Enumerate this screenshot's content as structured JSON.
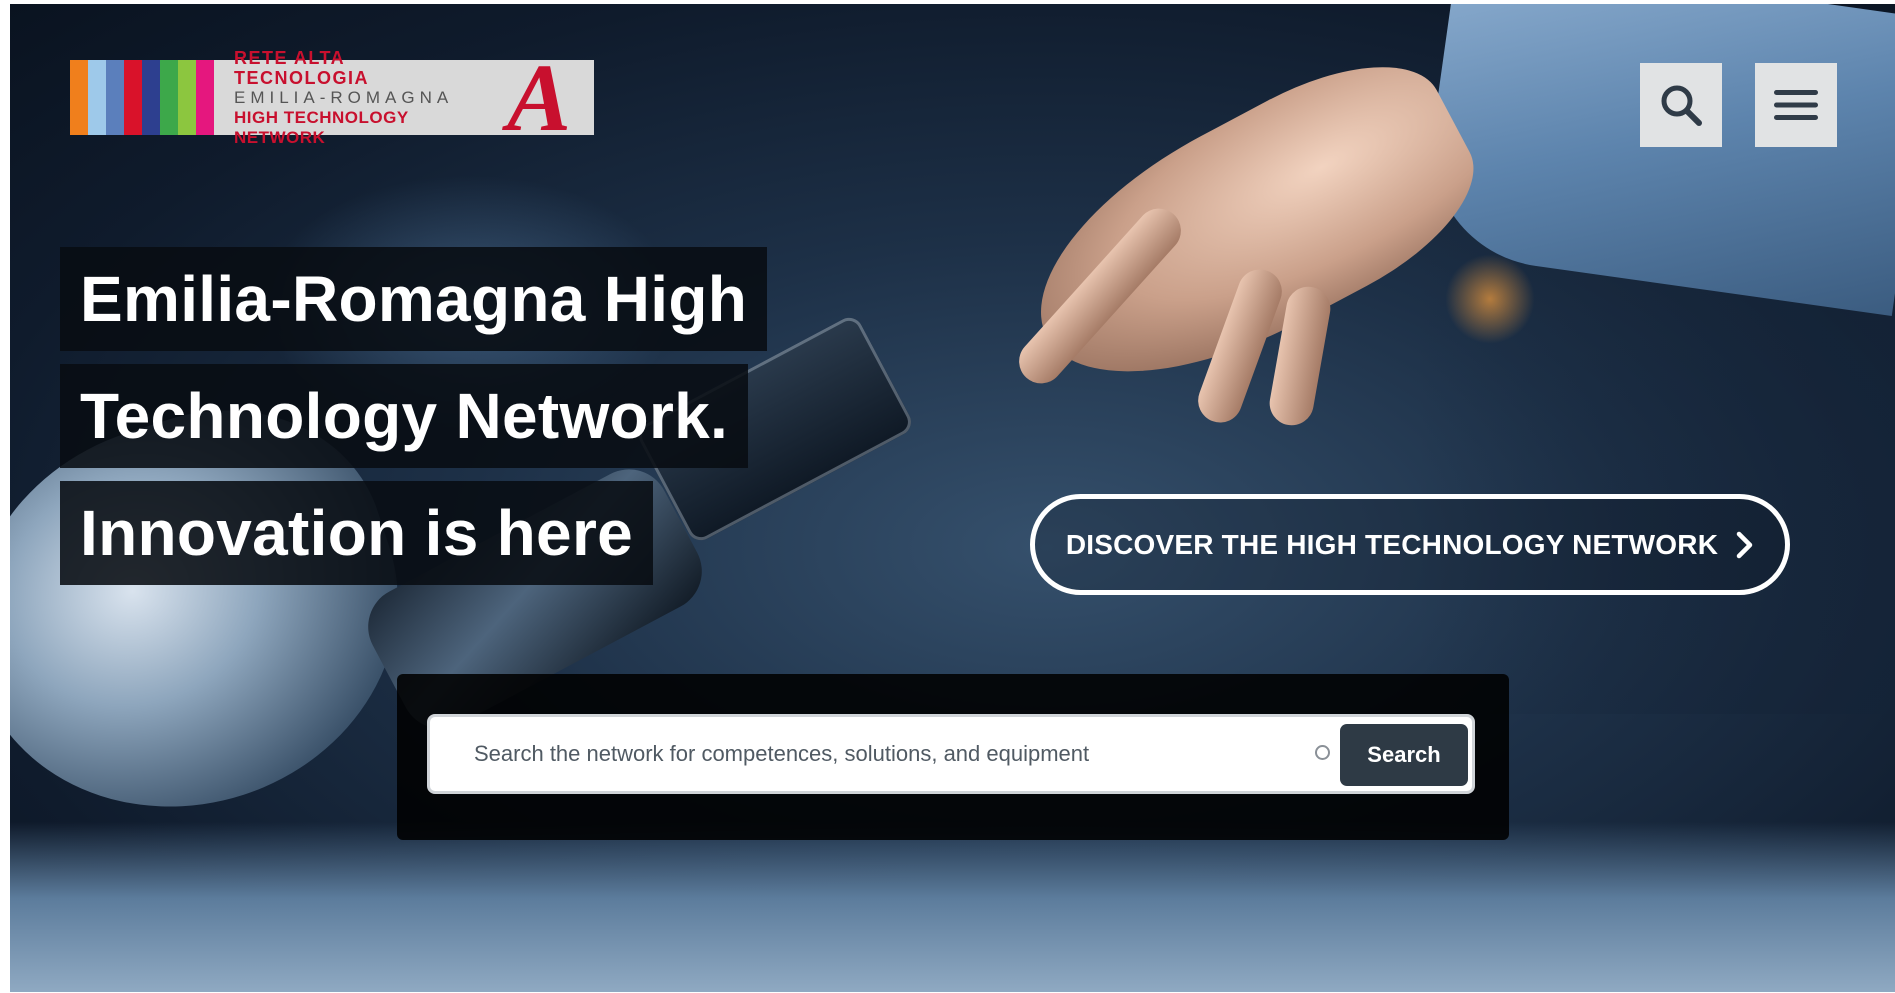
{
  "header": {
    "logo": {
      "line1": "RETE ALTA TECNOLOGIA",
      "line2": "EMILIA-ROMAGNA",
      "line3": "HIGH TECHNOLOGY NETWORK",
      "mark": "A",
      "stripe_colors": [
        "#f07f1c",
        "#9ec9ea",
        "#5b7fbc",
        "#d9122a",
        "#2d3f8f",
        "#3da84a",
        "#8cc63f",
        "#e5177e"
      ],
      "brand_color": "#c8102e"
    },
    "search_icon": "search-icon",
    "menu_icon": "hamburger-menu-icon"
  },
  "hero": {
    "headline_lines": [
      "Emilia-Romagna High",
      "Technology Network.",
      "Innovation is here"
    ],
    "discover_label": "DISCOVER THE HIGH TECHNOLOGY NETWORK",
    "discover_icon": "chevron-right-icon"
  },
  "search": {
    "placeholder": "Search the network for competences, solutions, and equipment",
    "value": "",
    "button_label": "Search"
  }
}
